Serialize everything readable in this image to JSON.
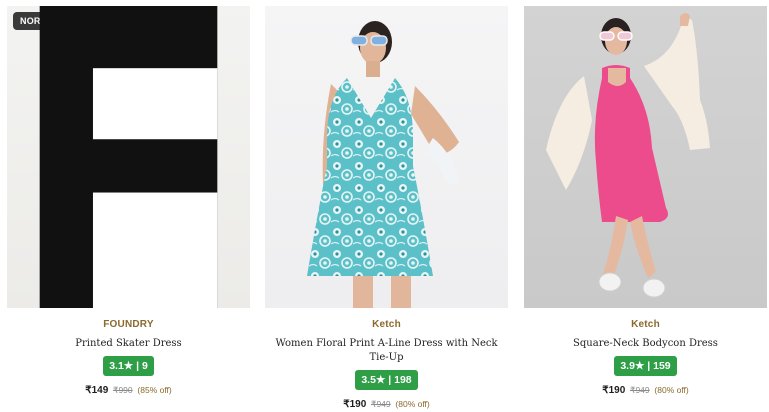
{
  "products": [
    {
      "badge": "NORETURN",
      "brand": "FOUNDRY",
      "name": "Printed Skater Dress",
      "rating": "3.1★ | 9",
      "price": "₹149",
      "mrp": "₹990",
      "discount": "(85% off)"
    },
    {
      "brand": "Ketch",
      "name": "Women Floral Print A-Line Dress with Neck Tie-Up",
      "rating": "3.5★ | 198",
      "price": "₹190",
      "mrp": "₹949",
      "discount": "(80% off)"
    },
    {
      "brand": "Ketch",
      "name": "Square-Neck Bodycon Dress",
      "rating": "3.9★ | 159",
      "price": "₹190",
      "mrp": "₹949",
      "discount": "(80% off)"
    }
  ],
  "colors": {
    "brand_text": "#8a6a2c",
    "rating_bg": "#2e9e47",
    "badge_bg": "#3a3a3a"
  }
}
